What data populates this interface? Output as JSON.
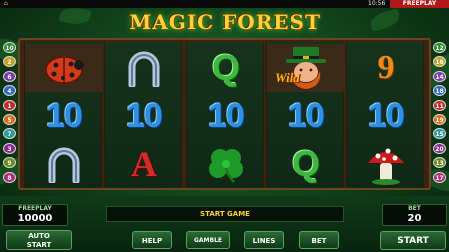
{
  "status_bar": {
    "clock": "10:56",
    "mode": "FREEPLAY",
    "home_icon": "home-icon"
  },
  "title": "MAGIC FOREST",
  "reels": [
    [
      {
        "type": "icon",
        "icon": "ladybug-icon"
      },
      {
        "type": "text",
        "text": "10",
        "style": "ten"
      },
      {
        "type": "icon",
        "icon": "horseshoe-icon"
      }
    ],
    [
      {
        "type": "icon",
        "icon": "horseshoe-icon"
      },
      {
        "type": "text",
        "text": "10",
        "style": "ten"
      },
      {
        "type": "text",
        "text": "A",
        "style": "ace"
      }
    ],
    [
      {
        "type": "text",
        "text": "Q",
        "style": "q"
      },
      {
        "type": "text",
        "text": "10",
        "style": "ten"
      },
      {
        "type": "icon",
        "icon": "clover-icon"
      }
    ],
    [
      {
        "type": "icon",
        "icon": "leprechaun-wild-icon",
        "wild_text": "Wild"
      },
      {
        "type": "text",
        "text": "10",
        "style": "ten"
      },
      {
        "type": "text",
        "text": "Q",
        "style": "q"
      }
    ],
    [
      {
        "type": "text",
        "text": "9",
        "style": "nine"
      },
      {
        "type": "text",
        "text": "10",
        "style": "ten"
      },
      {
        "type": "icon",
        "icon": "mushroom-icon"
      }
    ]
  ],
  "lines_left": [
    "10",
    "2",
    "6",
    "4",
    "1",
    "5",
    "7",
    "3",
    "9",
    "8"
  ],
  "lines_right": [
    "12",
    "16",
    "14",
    "18",
    "11",
    "19",
    "15",
    "20",
    "13",
    "17"
  ],
  "line_colors": [
    "#2a8a2a",
    "#c8a020",
    "#7a3aa8",
    "#2a6ac8",
    "#c82a2a",
    "#d86a18",
    "#2a9a9a",
    "#8a2a8a",
    "#6a8a1a",
    "#b0287a"
  ],
  "freeplay": {
    "label": "FREEPLAY",
    "value": "10000"
  },
  "bet": {
    "label": "BET",
    "value": "20"
  },
  "message": "START GAME",
  "buttons": {
    "autostart_line1": "AUTO",
    "autostart_line2": "START",
    "help": "HELP",
    "gamble": "GAMBLE",
    "lines": "LINES",
    "bet": "BET",
    "start": "START"
  }
}
